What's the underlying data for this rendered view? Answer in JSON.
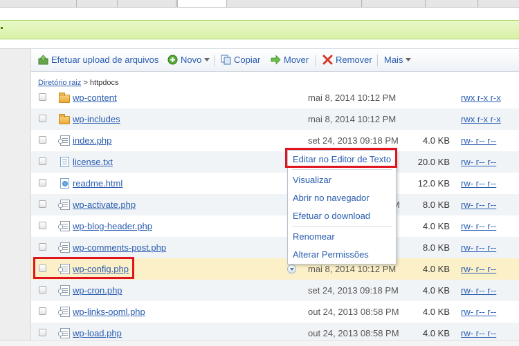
{
  "toolbar": {
    "upload_label": "Efetuar upload de arquivos",
    "new_label": "Novo",
    "copy_label": "Copiar",
    "move_label": "Mover",
    "remove_label": "Remover",
    "more_label": "Mais"
  },
  "breadcrumb": {
    "root_label": "Diretório raiz",
    "separator": ">",
    "current": "httpdocs"
  },
  "files": [
    {
      "name": "wp-content",
      "type": "folder",
      "date": "mai 8, 2014 10:12 PM",
      "size": "",
      "perms": "rwx r-x r-x"
    },
    {
      "name": "wp-includes",
      "type": "folder",
      "date": "mai 8, 2014 10:12 PM",
      "size": "",
      "perms": "rwx r-x r-x"
    },
    {
      "name": "index.php",
      "type": "php",
      "date": "set 24, 2013 09:18 PM",
      "size": "4.0 KB",
      "perms": "rw- r-- r--"
    },
    {
      "name": "license.txt",
      "type": "txt",
      "date": "",
      "size": "20.0 KB",
      "perms": "rw- r-- r--"
    },
    {
      "name": "readme.html",
      "type": "html",
      "date": "",
      "size": "12.0 KB",
      "perms": "rw- r-- r--"
    },
    {
      "name": "wp-activate.php",
      "type": "php",
      "date": "M",
      "size": "8.0 KB",
      "perms": "rw- r-- r--"
    },
    {
      "name": "wp-blog-header.php",
      "type": "php",
      "date": "",
      "size": "4.0 KB",
      "perms": "rw- r-- r--"
    },
    {
      "name": "wp-comments-post.php",
      "type": "php",
      "date": "",
      "size": "8.0 KB",
      "perms": "rw- r-- r--"
    },
    {
      "name": "wp-config.php",
      "type": "php",
      "date": "mai 8, 2014 10:12 PM",
      "size": "4.0 KB",
      "perms": "rw- r-- r--"
    },
    {
      "name": "wp-cron.php",
      "type": "php",
      "date": "set 24, 2013 09:18 PM",
      "size": "4.0 KB",
      "perms": "rw- r-- r--"
    },
    {
      "name": "wp-links-opml.php",
      "type": "php",
      "date": "out 24, 2013 08:58 PM",
      "size": "4.0 KB",
      "perms": "rw- r-- r--"
    },
    {
      "name": "wp-load.php",
      "type": "php",
      "date": "out 24, 2013 08:58 PM",
      "size": "4.0 KB",
      "perms": "rw- r-- r--"
    }
  ],
  "context_menu": {
    "edit_text": "Editar no Editor de Texto",
    "view": "Visualizar",
    "open_browser": "Abrir no navegador",
    "download": "Efetuar o download",
    "rename": "Renomear",
    "permissions": "Alterar Permissões"
  },
  "colors": {
    "link": "#2a5db0",
    "highlight_red": "#e0141e",
    "selected_row": "#fcf0c8",
    "message_bar": "#d8f1a6"
  }
}
